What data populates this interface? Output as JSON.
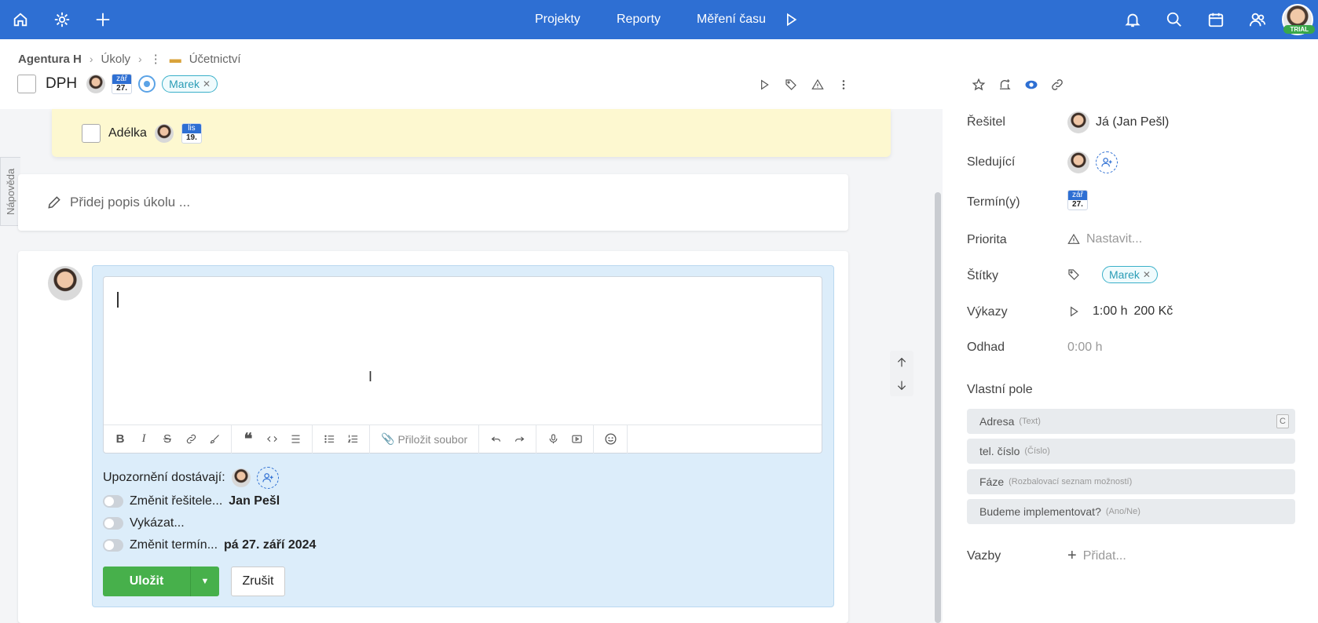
{
  "topbar": {
    "nav": [
      "Projekty",
      "Reporty",
      "Měření času"
    ],
    "trial_label": "TRIAL",
    "brand_color": "#2e6fd3"
  },
  "breadcrumb": {
    "items": [
      "Agentura H",
      "Úkoly",
      "Účetnictví"
    ]
  },
  "task": {
    "title": "DPH",
    "date_month": "zář",
    "date_day": "27.",
    "tag": "Marek"
  },
  "subtask": {
    "name": "Adélka",
    "date_month": "lis",
    "date_day": "19."
  },
  "help_tab": "Nápověda",
  "description_placeholder": "Přidej popis úkolu ...",
  "editor": {
    "attach_label": "Přiložit soubor",
    "notify_label": "Upozornění dostávají:",
    "options": [
      {
        "label": "Změnit řešitele...",
        "value": "Jan Pešl"
      },
      {
        "label": "Vykázat...",
        "value": ""
      },
      {
        "label": "Změnit termín...",
        "value": "pá 27. září 2024"
      }
    ],
    "save_label": "Uložit",
    "cancel_label": "Zrušit"
  },
  "panel": {
    "resitel_label": "Řešitel",
    "resitel_value": "Já (Jan Pešl)",
    "sledujici_label": "Sledující",
    "termin_label": "Termín(y)",
    "termin_month": "zář",
    "termin_day": "27.",
    "priorita_label": "Priorita",
    "priorita_value": "Nastavit...",
    "stitky_label": "Štítky",
    "stitky_tag": "Marek",
    "vykazy_label": "Výkazy",
    "vykazy_time": "1:00 h",
    "vykazy_money": "200 Kč",
    "odhad_label": "Odhad",
    "odhad_value": "0:00 h",
    "custom_fields_label": "Vlastní pole",
    "custom_fields": [
      {
        "name": "Adresa",
        "type": "(Text)"
      },
      {
        "name": "tel. číslo",
        "type": "(Číslo)"
      },
      {
        "name": "Fáze",
        "type": "(Rozbalovací seznam možností)"
      },
      {
        "name": "Budeme implementovat?",
        "type": "(Ano/Ne)"
      }
    ],
    "custom_field_button": "C",
    "vazby_label": "Vazby",
    "vazby_value": "Přidat..."
  }
}
